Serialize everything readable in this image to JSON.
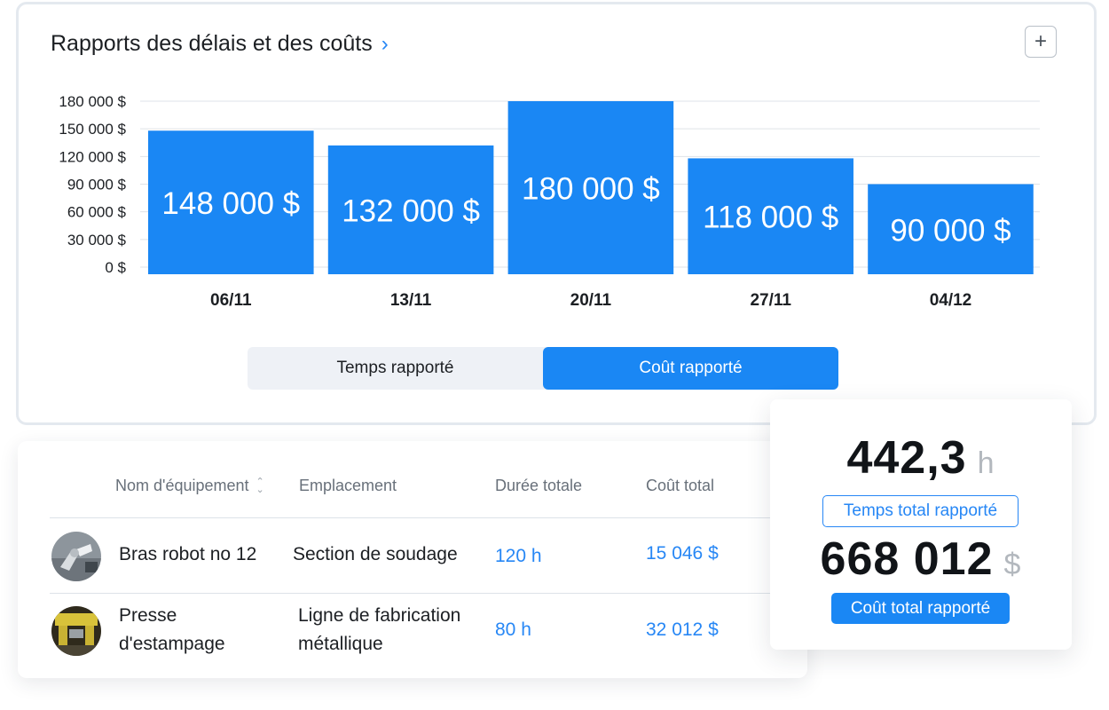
{
  "chart_card": {
    "title": "Rapports des délais et des coûts",
    "add_label": "+",
    "toggle": {
      "time_label": "Temps rapporté",
      "cost_label": "Coût rapporté",
      "active": "cost"
    }
  },
  "chart_data": {
    "type": "bar",
    "categories": [
      "06/11",
      "13/11",
      "20/11",
      "27/11",
      "04/12"
    ],
    "values": [
      148000,
      132000,
      180000,
      118000,
      90000
    ],
    "data_labels": [
      "148 000 $",
      "132 000 $",
      "180 000 $",
      "118 000 $",
      "90 000 $"
    ],
    "y_ticks": [
      0,
      30000,
      60000,
      90000,
      120000,
      150000,
      180000
    ],
    "y_tick_labels": [
      "0 $",
      "30 000 $",
      "60 000 $",
      "90 000 $",
      "120 000 $",
      "150 000 $",
      "180 000 $"
    ],
    "ylim": [
      0,
      180000
    ],
    "grid": true,
    "bar_color": "#1a87f4"
  },
  "table": {
    "headers": {
      "name": "Nom d'équipement",
      "location": "Emplacement",
      "duration": "Durée totale",
      "cost": "Coût total"
    },
    "rows": [
      {
        "name_line1": "Bras robot no 12",
        "name_line2": "",
        "location_line1": "Section de soudage",
        "location_line2": "",
        "duration": "120 h",
        "cost": "15 046 $"
      },
      {
        "name_line1": "Presse",
        "name_line2": "d'estampage",
        "location_line1": "Ligne de fabrication",
        "location_line2": "métallique",
        "duration": "80 h",
        "cost": "32 012 $"
      }
    ]
  },
  "summary": {
    "hours_value": "442,3",
    "hours_unit": "h",
    "hours_label": "Temps total rapporté",
    "cost_value": "668 012",
    "cost_unit": "$",
    "cost_label": "Coût total rapporté"
  },
  "colors": {
    "accent": "#1a87f4",
    "link": "#2787f5",
    "border": "#e4e9ef"
  }
}
